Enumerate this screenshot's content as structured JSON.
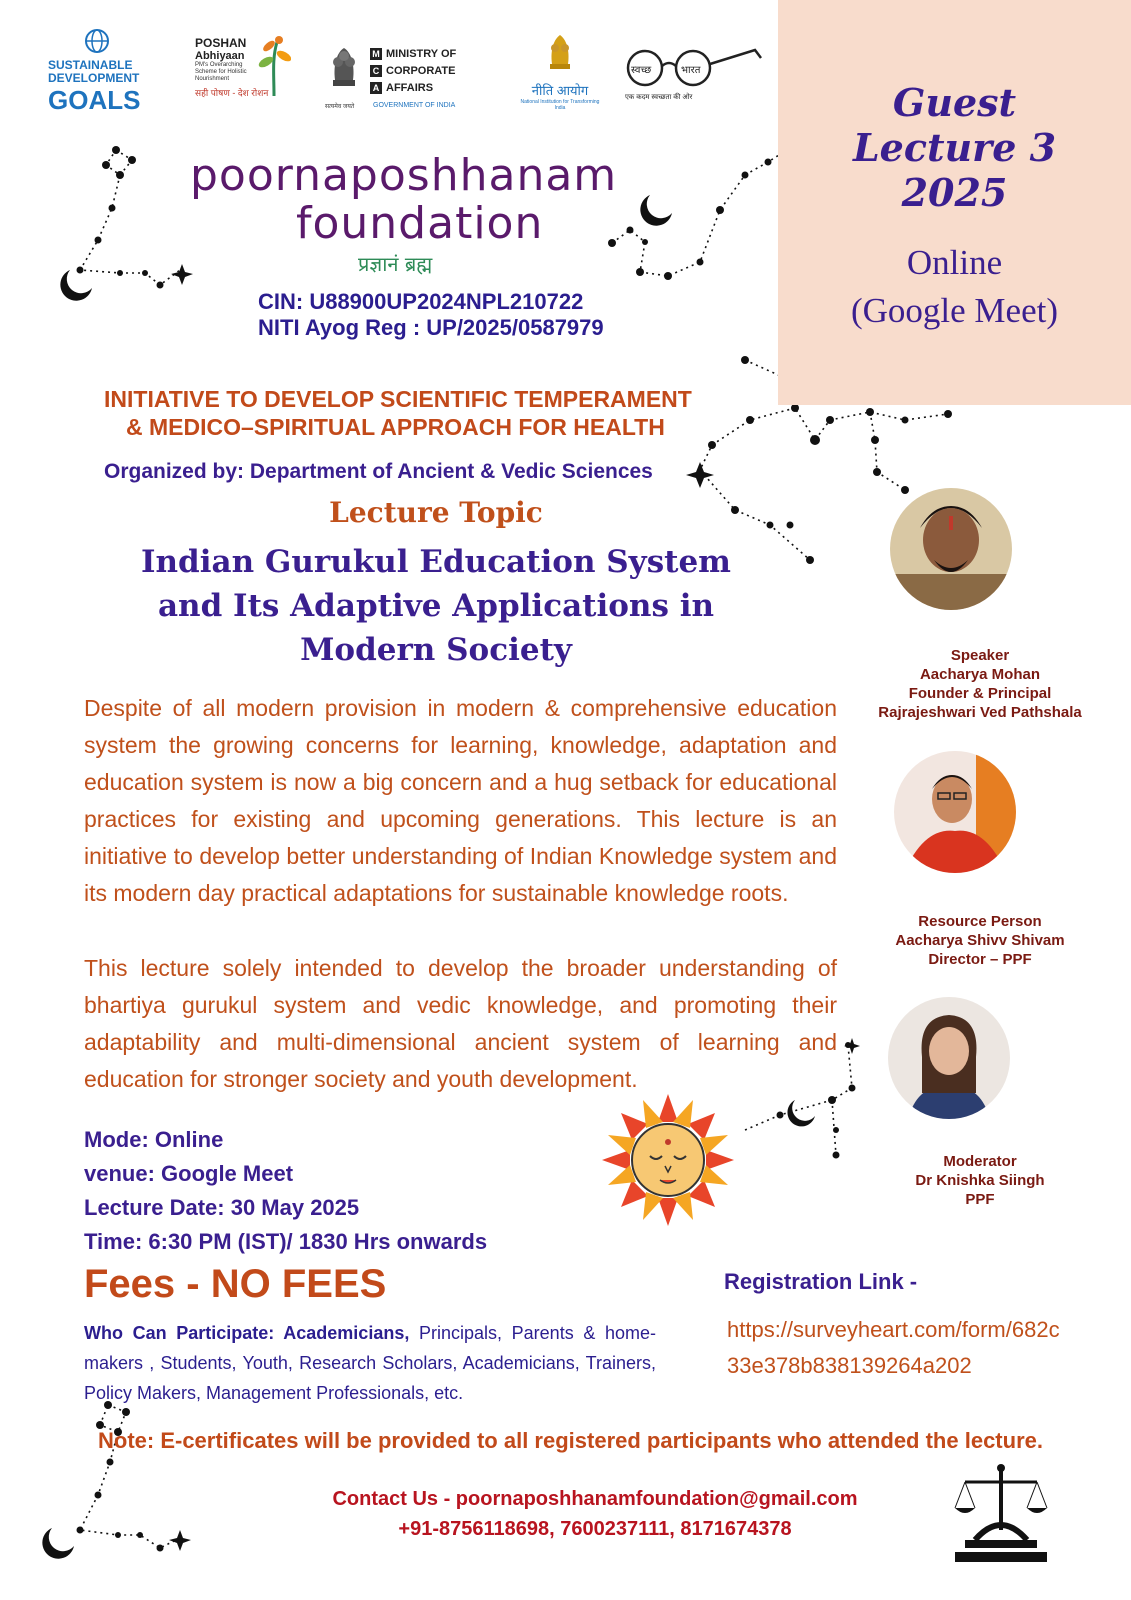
{
  "panel": {
    "guest_line1": "Guest",
    "guest_line2": "Lecture 3",
    "guest_line3": "2025",
    "online_line1": "Online",
    "online_line2": "(Google Meet)"
  },
  "logos": {
    "sdg_line1": "SUSTAINABLE",
    "sdg_line2": "DEVELOPMENT",
    "sdg_line3": "GOALS",
    "poshan_line1": "POSHAN",
    "poshan_line2": "Abhiyaan",
    "poshan_sub": "PM's Overarching Scheme for Holistic Nourishment",
    "poshan_hindi": "सही पोषण - देश रोशन",
    "mca_m": "MINISTRY OF",
    "mca_c": "CORPORATE",
    "mca_a": "AFFAIRS",
    "mca_gov": "GOVERNMENT OF INDIA",
    "emblem_caption": "सत्यमेव जयते",
    "niti_hindi": "नीति आयोग",
    "niti_sub": "National Institution for Transforming India",
    "swachh_left": "स्वच्छ",
    "swachh_right": "भारत",
    "swachh_sub": "एक कदम स्वच्छता की ओर"
  },
  "foundation": {
    "name_line1": "poornaposhhanam",
    "name_line2": "foundation",
    "motto": "प्रज्ञानं ब्रह्म",
    "cin": "CIN: U88900UP2024NPL210722",
    "niti_reg": "NITI Ayog Reg : UP/2025/0587979"
  },
  "initiative": {
    "line1": "INITIATIVE TO DEVELOP SCIENTIFIC TEMPERAMENT",
    "line2": "& MEDICO–SPIRITUAL APPROACH FOR HEALTH",
    "organized_by": "Organized by: Department of Ancient & Vedic Sciences"
  },
  "lecture": {
    "topic_label": "Lecture Topic",
    "title_line1": "Indian Gurukul Education System",
    "title_line2": "and Its Adaptive Applications in",
    "title_line3": "Modern Society",
    "para1": "Despite of all modern provision in modern & comprehensive education system the growing concerns for learning, knowledge, adaptation and education system is now a big concern and a hug setback for educational practices for existing and upcoming generations. This lecture is an initiative to develop better understanding of Indian Knowledge system and its modern day practical adaptations for sustainable knowledge roots.",
    "para2": "This lecture solely intended to develop the broader understanding of bhartiya gurukul system and vedic knowledge, and promoting their adaptability and multi-dimensional ancient system of learning and education for stronger society and youth development."
  },
  "details": {
    "mode": "Mode: Online",
    "venue": "venue: Google Meet",
    "date": "Lecture Date: 30 May 2025",
    "time": "Time: 6:30 PM (IST)/ 1830 Hrs onwards"
  },
  "fees": "Fees - NO FEES",
  "participants": {
    "label": "Who Can Participate: Academicians,",
    "list": " Principals, Parents & home-makers , Students, Youth, Research Scholars, Academicians, Trainers, Policy Makers, Management Professionals, etc."
  },
  "registration": {
    "heading": "Registration Link -",
    "link_line1": "https://surveyheart.com/form/682c",
    "link_line2": "33e378b838139264a202"
  },
  "note": "Note: E-certificates will be provided to all registered participants who attended the lecture.",
  "contact": {
    "line1": "Contact Us - poornaposhhanamfoundation@gmail.com",
    "line2": "+91-8756118698, 7600237111, 8171674378"
  },
  "people": [
    {
      "role": "Speaker",
      "name": "Aacharya Mohan",
      "title1": "Founder & Principal",
      "title2": "Rajrajeshwari Ved Pathshala"
    },
    {
      "role": "Resource Person",
      "name": "Aacharya Shivv Shivam",
      "title1": "Director – PPF"
    },
    {
      "role": "Moderator",
      "name": "Dr Knishka Siingh",
      "title1": "PPF"
    }
  ],
  "colors": {
    "purple": "#3a1f8f",
    "orange": "#c24a1a",
    "peach": "#f8dccc",
    "red": "#b8141f"
  }
}
